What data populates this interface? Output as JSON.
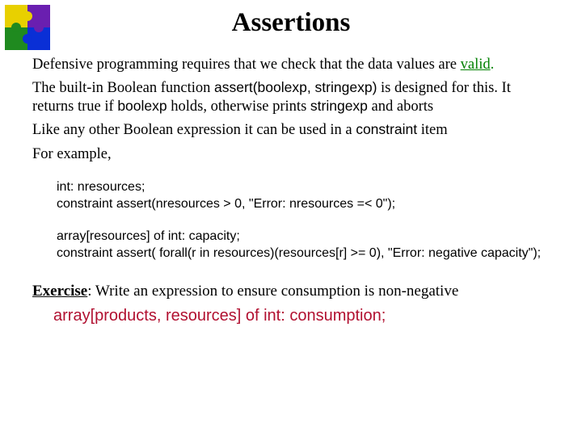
{
  "title": "Assertions",
  "para1_a": "Defensive programming requires that we check that the data values are ",
  "para1_valid": "valid",
  "para1_b": ".",
  "para2_a": "The built-in Boolean function ",
  "para2_fn": "assert(boolexp, stringexp)",
  "para2_b": " is designed for this. It returns true if ",
  "para2_boolexp": "boolexp",
  "para2_c": " holds, otherwise prints ",
  "para2_stringexp": "stringexp",
  "para2_d": " and aborts",
  "para3_a": "Like any other Boolean expression it can be used in a ",
  "para3_constraint": "constraint",
  "para3_b": " item",
  "para4": "For example,",
  "code1": "int: nresources;",
  "code2": "constraint assert(nresources > 0, \"Error: nresources =< 0\");",
  "code3": "array[resources] of int: capacity;",
  "code4": "constraint assert( forall(r in resources)(resources[r] >= 0), \"Error: negative capacity\");",
  "exercise_label": "Exercise",
  "exercise_text": ": Write an expression to ensure consumption is non-negative",
  "exercise_code": "array[products, resources] of int: consumption;"
}
